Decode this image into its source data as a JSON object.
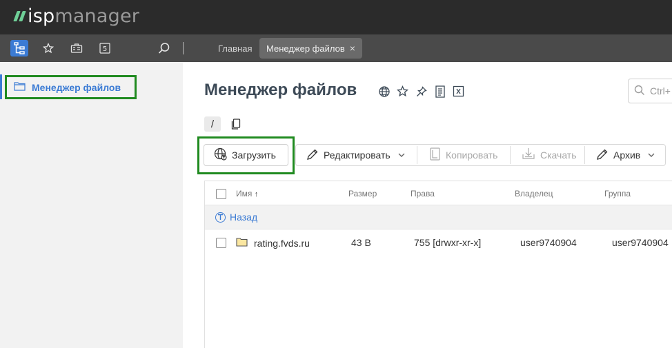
{
  "logo": {
    "text_bold": "isp",
    "text_light": "manager"
  },
  "navbar": {
    "icons": [
      "sitemap-icon",
      "star-icon",
      "briefcase-icon",
      "number-5-icon",
      "search-icon"
    ],
    "badge_number": "5",
    "tabs": [
      {
        "label": "Главная",
        "active": false
      },
      {
        "label": "Менеджер файлов",
        "active": true,
        "close": "×"
      }
    ]
  },
  "sidebar": {
    "items": [
      {
        "label": "Менеджер файлов",
        "icon": "folder-icon",
        "active": true
      }
    ]
  },
  "main": {
    "title": "Менеджер файлов",
    "search_placeholder": "Ctrl+",
    "path": "/",
    "toolbar": {
      "upload": "Загрузить",
      "edit": "Редактировать",
      "copy": "Копировать",
      "download": "Скачать",
      "archive": "Архив"
    },
    "table": {
      "columns": [
        "Имя",
        "Размер",
        "Права",
        "Владелец",
        "Группа"
      ],
      "sort_indicator": "↑",
      "back_label": "Назад",
      "rows": [
        {
          "name": "rating.fvds.ru",
          "size": "43 B",
          "perms": "755 [drwxr-xr-x]",
          "owner": "user9740904",
          "group": "user9740904"
        }
      ]
    }
  },
  "colors": {
    "accent": "#3b7bd4",
    "highlight": "#1f8a1f",
    "topbar": "#2b2b2b",
    "navbar": "#4a4a4a"
  }
}
